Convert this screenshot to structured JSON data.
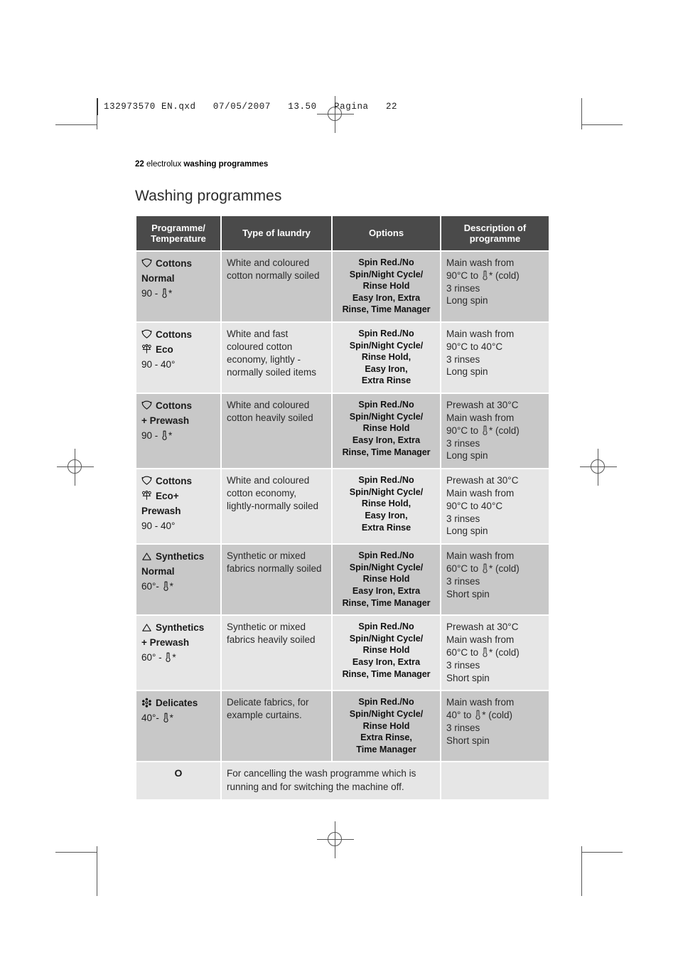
{
  "slug": {
    "text": "132973570 EN.qxd   07/05/2007   13.50   Pagina   22"
  },
  "folio": {
    "page_number": "22",
    "brand": "electrolux",
    "section": "washing programmes"
  },
  "page_title": "Washing programmes",
  "table": {
    "headers": [
      "Programme/\nTemperature",
      "Type of laundry",
      "Options",
      "Description of\nprogramme"
    ],
    "header_lines": {
      "h1_line1": "Programme/",
      "h1_line2": "Temperature",
      "h2": "Type of laundry",
      "h3": "Options",
      "h4_line1": "Description of",
      "h4_line2": "programme"
    },
    "rows": [
      {
        "shade": "dark",
        "icon": "cotton-boll-icon",
        "programme_name": "Cottons",
        "programme_line2": "Normal",
        "temperature_prefix": "90 - ",
        "temperature_icon": "thermometer-cold-icon",
        "temperature_suffix": "*",
        "type_of_laundry": "White and coloured cotton normally soiled",
        "options": [
          "Spin Red./No",
          "Spin/Night Cycle/",
          "Rinse Hold",
          "Easy Iron, Extra",
          "Rinse, Time Manager"
        ],
        "description": [
          "Main wash from",
          "90°C to [therm]* (cold)",
          "3 rinses",
          "Long spin"
        ],
        "desc_line1": "Main wash from",
        "desc_line2_pre": "90°C to ",
        "desc_line2_post": "* (cold)",
        "desc_line3": "3 rinses",
        "desc_line4": "Long spin"
      },
      {
        "shade": "light",
        "icon": "cotton-boll-icon",
        "icon2": "eco-icon",
        "programme_name": "Cottons",
        "programme_line2": "Eco",
        "temperature_prefix": "90 - 40°",
        "type_of_laundry": "White and fast coloured cotton economy, lightly - normally soiled items",
        "options": [
          "Spin Red./No",
          "Spin/Night Cycle/",
          "Rinse Hold,",
          "Easy Iron,",
          "Extra Rinse"
        ],
        "desc_line1": "Main wash from",
        "desc_line2_plain": "90°C to 40°C",
        "desc_line3": "3 rinses",
        "desc_line4": "Long spin"
      },
      {
        "shade": "dark",
        "icon": "cotton-boll-icon",
        "programme_name": "Cottons",
        "programme_line2": "+ Prewash",
        "temperature_prefix": "90 - ",
        "temperature_icon": "thermometer-cold-icon",
        "temperature_suffix": "*",
        "type_of_laundry": "White and coloured cotton heavily soiled",
        "options": [
          "Spin Red./No",
          "Spin/Night Cycle/",
          "Rinse Hold",
          "Easy Iron, Extra",
          "Rinse, Time Manager"
        ],
        "desc_line0": "Prewash at 30°C",
        "desc_line1": "Main wash from",
        "desc_line2_pre": "90°C to ",
        "desc_line2_post": "* (cold)",
        "desc_line3": "3 rinses",
        "desc_line4": "Long spin"
      },
      {
        "shade": "light",
        "icon": "cotton-boll-icon",
        "icon2": "eco-icon",
        "programme_name": "Cottons",
        "programme_line2": "Eco+",
        "programme_line3": "Prewash",
        "temperature_prefix": "90 - 40°",
        "type_of_laundry": "White and coloured cotton economy, lightly-normally soiled",
        "options": [
          "Spin Red./No",
          "Spin/Night Cycle/",
          "Rinse Hold,",
          "Easy Iron,",
          "Extra Rinse"
        ],
        "desc_line0": "Prewash at 30°C",
        "desc_line1": "Main wash from",
        "desc_line2_plain": "90°C to 40°C",
        "desc_line3": "3 rinses",
        "desc_line4": "Long spin"
      },
      {
        "shade": "dark",
        "icon": "triangle-synthetics-icon",
        "programme_name": "Synthetics",
        "programme_line2": "Normal",
        "temperature_prefix": "60°- ",
        "temperature_icon": "thermometer-cold-icon",
        "temperature_suffix": "*",
        "type_of_laundry": "Synthetic or mixed fabrics normally soiled",
        "options": [
          "Spin Red./No",
          "Spin/Night Cycle/",
          "Rinse Hold",
          "Easy Iron, Extra",
          "Rinse, Time Manager"
        ],
        "desc_line1": "Main wash from",
        "desc_line2_pre": "60°C to ",
        "desc_line2_post": "* (cold)",
        "desc_line3": "3 rinses",
        "desc_line4": "Short spin"
      },
      {
        "shade": "light",
        "icon": "triangle-synthetics-icon",
        "programme_name": "Synthetics",
        "programme_line2": "+ Prewash",
        "temperature_prefix": "60° - ",
        "temperature_icon": "thermometer-cold-icon",
        "temperature_suffix": "*",
        "type_of_laundry": "Synthetic or mixed fabrics heavily soiled",
        "options": [
          "Spin Red./No",
          "Spin/Night Cycle/",
          "Rinse Hold",
          "Easy Iron, Extra",
          "Rinse, Time Manager"
        ],
        "desc_line0": "Prewash at 30°C",
        "desc_line1": "Main wash from",
        "desc_line2_pre": "60°C to ",
        "desc_line2_post": "* (cold)",
        "desc_line3": "3 rinses",
        "desc_line4": "Short spin"
      },
      {
        "shade": "dark",
        "icon": "flower-delicates-icon",
        "programme_name": "Delicates",
        "temperature_prefix": "40°- ",
        "temperature_icon": "thermometer-cold-icon",
        "temperature_suffix": "*",
        "type_of_laundry": "Delicate fabrics, for example curtains.",
        "options": [
          "Spin Red./No",
          "Spin/Night Cycle/",
          "Rinse Hold",
          "Extra Rinse,",
          "Time Manager"
        ],
        "desc_line1": "Main wash from",
        "desc_line2_pre": "40° to ",
        "desc_line2_post": "* (cold)",
        "desc_line3": "3 rinses",
        "desc_line4": "Short spin"
      }
    ],
    "off_row": {
      "shade": "light",
      "symbol": "O",
      "text": "For cancelling the wash programme which is running and for switching the machine off."
    }
  },
  "colors": {
    "header_bg": "#4a4a4a",
    "header_text": "#ffffff",
    "row_dark": "#c8c8c8",
    "row_light": "#e6e6e6",
    "body_text": "#2a2a2a",
    "page_bg": "#ffffff"
  }
}
